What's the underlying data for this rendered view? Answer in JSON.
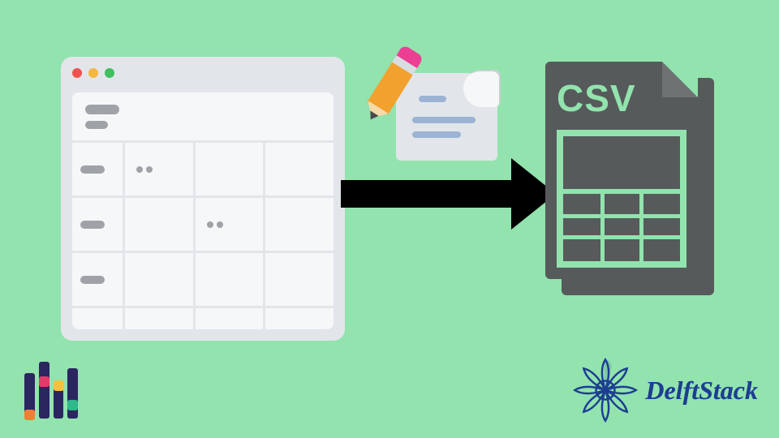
{
  "colors": {
    "background": "#92e3ae",
    "csv_fill": "#565a5b",
    "brand": "#1d3e91"
  },
  "csv": {
    "label": "CSV"
  },
  "brand": {
    "name": "DelftStack"
  },
  "icons": {
    "table": "spreadsheet-window-icon",
    "note": "paper-pencil-icon",
    "arrow": "right-arrow-icon",
    "csv": "csv-file-icon",
    "bars": "bars-logo-icon",
    "mandala": "mandala-logo-icon"
  }
}
